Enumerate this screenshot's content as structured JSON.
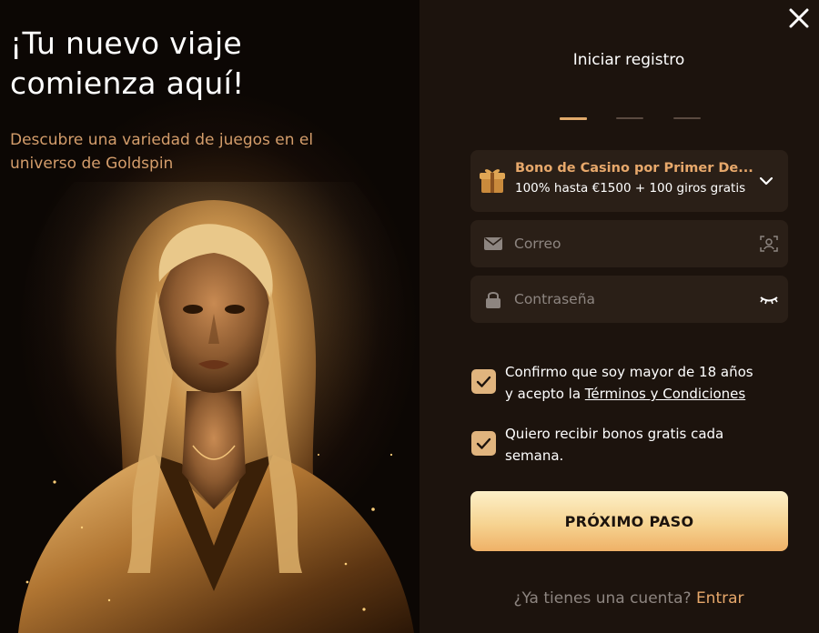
{
  "hero": {
    "title_line1": "¡Tu nuevo viaje",
    "title_line2": "comienza aquí!",
    "subtitle_line1": "Descubre una variedad de juegos en el",
    "subtitle_line2": "universo de Goldspin"
  },
  "form": {
    "title": "Iniciar registro",
    "steps": [
      {
        "active": true
      },
      {
        "active": false
      },
      {
        "active": false
      }
    ],
    "bonus": {
      "title": "Bono de Casino por Primer De...",
      "description": "100% hasta €1500 + 100 giros gratis",
      "icon": "gift-icon"
    },
    "email": {
      "placeholder": "Correo",
      "value": "",
      "icon": "envelope-icon",
      "right_icon": "contact-icon"
    },
    "password": {
      "placeholder": "Contraseña",
      "value": "",
      "icon": "lock-icon",
      "right_icon": "eye-closed-icon"
    },
    "checks": [
      {
        "checked": true,
        "text_line1": "Confirmo que soy mayor de 18 años",
        "text_prefix": "y acepto la ",
        "link": "Términos y Condiciones"
      },
      {
        "checked": true,
        "text_line1": "Quiero recibir bonos gratis cada",
        "text_line2": "semana."
      }
    ],
    "next_button": "PRÓXIMO PASO",
    "login_prompt": "¿Ya tienes una cuenta?",
    "login_link": "Entrar"
  },
  "colors": {
    "accent": "#e7a86b",
    "panel_bg": "#1c130d",
    "field_bg": "#2a1f17"
  }
}
